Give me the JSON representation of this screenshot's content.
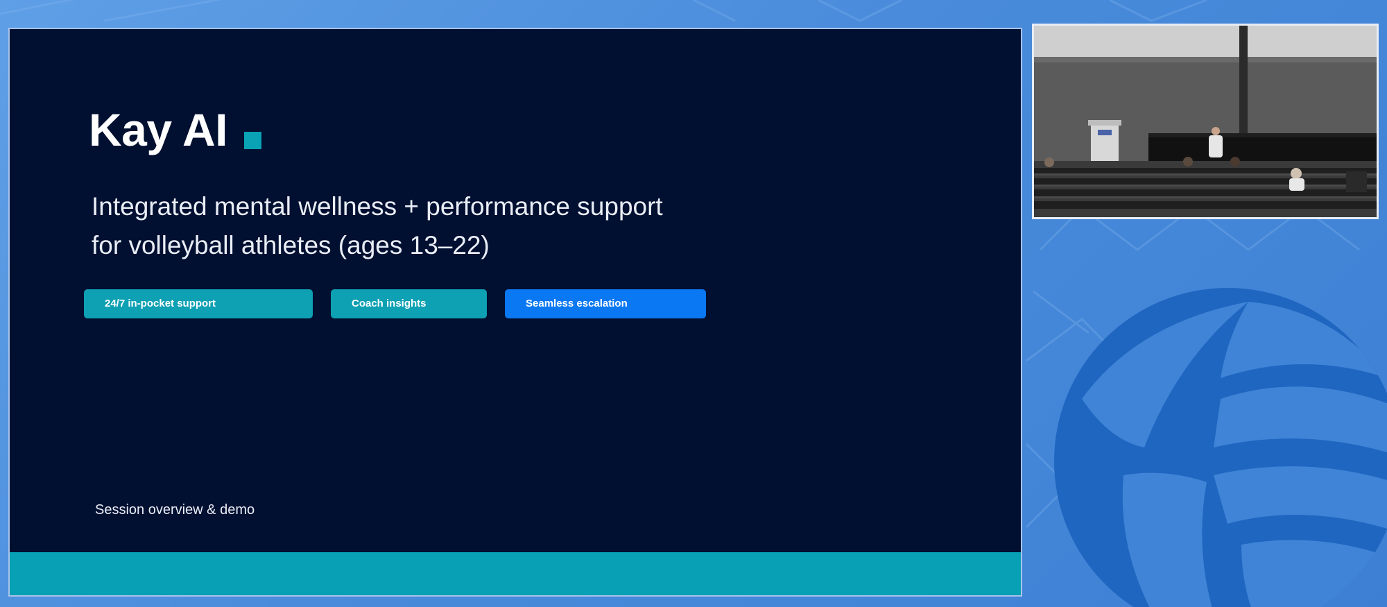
{
  "slide": {
    "title": "Kay AI",
    "subtitle_line1": "Integrated mental wellness + performance support",
    "subtitle_line2": "for volleyball athletes (ages 13–22)",
    "pills": [
      {
        "label": "24/7 in-pocket support",
        "color": "#0ea0b3"
      },
      {
        "label": "Coach insights",
        "color": "#0ea0b3"
      },
      {
        "label": "Seamless escalation",
        "color": "#0a78f2"
      }
    ],
    "session_label": "Session overview & demo",
    "background_color": "#010f31",
    "accent_color": "#07a0b5"
  },
  "camera": {
    "scene": "conference-room-video-feed"
  },
  "background": {
    "color": "#4a8cdb",
    "decoration": "volleyball-logo"
  }
}
